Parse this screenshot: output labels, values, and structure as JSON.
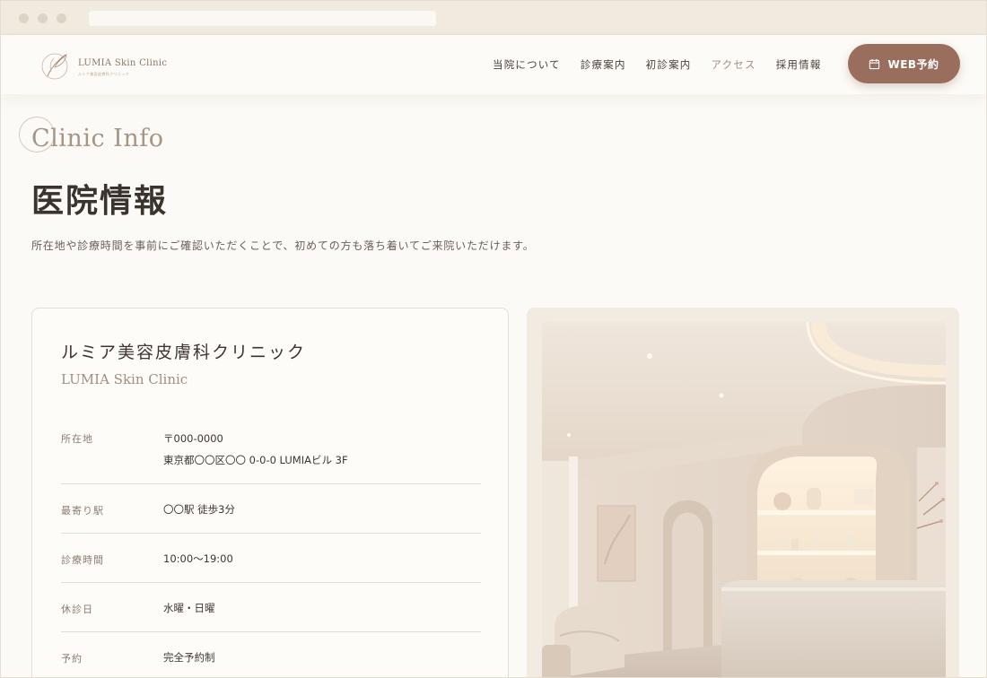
{
  "header": {
    "logo_text": "LUMIA Skin Clinic",
    "logo_sub": "ルミア美容皮膚科クリニック",
    "nav": [
      {
        "label": "当院について",
        "active": false
      },
      {
        "label": "診療案内",
        "active": false
      },
      {
        "label": "初診案内",
        "active": false
      },
      {
        "label": "アクセス",
        "active": true
      },
      {
        "label": "採用情報",
        "active": false
      }
    ],
    "cta_label": "WEB予約",
    "cta_icon": "calendar-icon"
  },
  "section": {
    "en_title": "Clinic Info",
    "title": "医院情報",
    "lead": "所在地や診療時間を事前にご確認いただくことで、初めての方も落ち着いてご来院いただけます。"
  },
  "clinic": {
    "name": "ルミア美容皮膚科クリニック",
    "name_en": "LUMIA Skin Clinic",
    "info": [
      {
        "label": "所在地",
        "lines": [
          "〒000-0000",
          "東京都〇〇区〇〇 0-0-0 LUMIAビル 3F"
        ]
      },
      {
        "label": "最寄り駅",
        "lines": [
          "〇〇駅 徒歩3分"
        ]
      },
      {
        "label": "診療時間",
        "lines": [
          "10:00〜19:00"
        ]
      },
      {
        "label": "休診日",
        "lines": [
          "水曜・日曜"
        ]
      },
      {
        "label": "予約",
        "lines": [
          "完全予約制"
        ]
      }
    ]
  },
  "colors": {
    "accent": "#9a6e5d",
    "background": "#fcfaf6",
    "text": "#3e3530"
  }
}
